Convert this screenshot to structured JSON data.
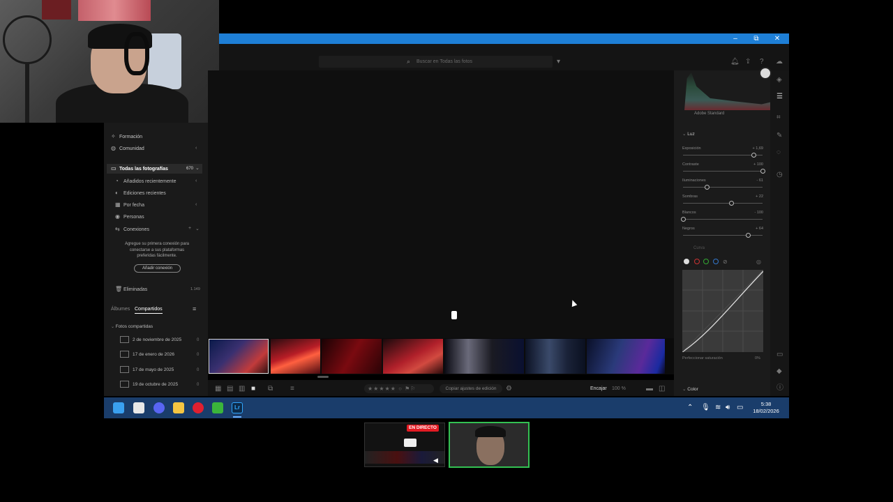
{
  "window": {
    "min": "–",
    "max": "⧉",
    "close": "✕"
  },
  "search": {
    "placeholder": "Buscar en Todas las fotos"
  },
  "sidebar": {
    "formacion": "Formación",
    "comunidad": "Comunidad",
    "todas": "Todas las fotografías",
    "todas_count": "670",
    "anadidas": "Añadidos recientemente",
    "ediciones": "Ediciones recientes",
    "por_fecha": "Por fecha",
    "personas": "Personas",
    "conexiones": "Conexiones",
    "conexiones_msg_1": "Agregue su primera conexión para",
    "conexiones_msg_2": "conectarse a sus plataformas",
    "conexiones_msg_3": "preferidas fácilmente.",
    "add_conexion": "Añadir conexión",
    "eliminadas": "Eliminadas",
    "eliminadas_count": "1.149",
    "tab_albumes": "Álbumes",
    "tab_compartidos": "Compartidos",
    "fotos_compartidas": "Fotos compartidas",
    "shared": [
      {
        "label": "2 de noviembre de 2025",
        "count": "0"
      },
      {
        "label": "17 de enero de 2026",
        "count": "0"
      },
      {
        "label": "17 de mayo de 2025",
        "count": "0"
      },
      {
        "label": "19 de octubre de 2025",
        "count": "0"
      }
    ]
  },
  "rightpanel": {
    "profile": "Adobe Standard",
    "luz": "Luz",
    "sliders": [
      {
        "label": "Exposición",
        "value": "+ 1,69",
        "level": 0.89
      },
      {
        "label": "Contraste",
        "value": "+ 100",
        "level": 1.0
      },
      {
        "label": "Iluminaciones",
        "value": "- 61",
        "level": 0.3
      },
      {
        "label": "Sombras",
        "value": "+ 22",
        "level": 0.61
      },
      {
        "label": "Blancos",
        "value": "- 100",
        "level": 0.0
      },
      {
        "label": "Negros",
        "value": "+ 64",
        "level": 0.82
      }
    ],
    "curva": "Curva",
    "refinar": "Perfeccionar saturación",
    "refinar_val": "0%",
    "color": "Color"
  },
  "bottombar": {
    "copiar": "Copiar ajustes de edición",
    "encajar": "Encajar",
    "zoom": "100 %"
  },
  "clock": {
    "time": "5:38",
    "date": "18/02/2026"
  },
  "preview": {
    "live": "EN DIRECTO"
  },
  "colors": {
    "titlebar": "#1e7fd6",
    "taskbar": "#1a3d6b",
    "live": "#e31b23",
    "active_border": "#33c152"
  }
}
